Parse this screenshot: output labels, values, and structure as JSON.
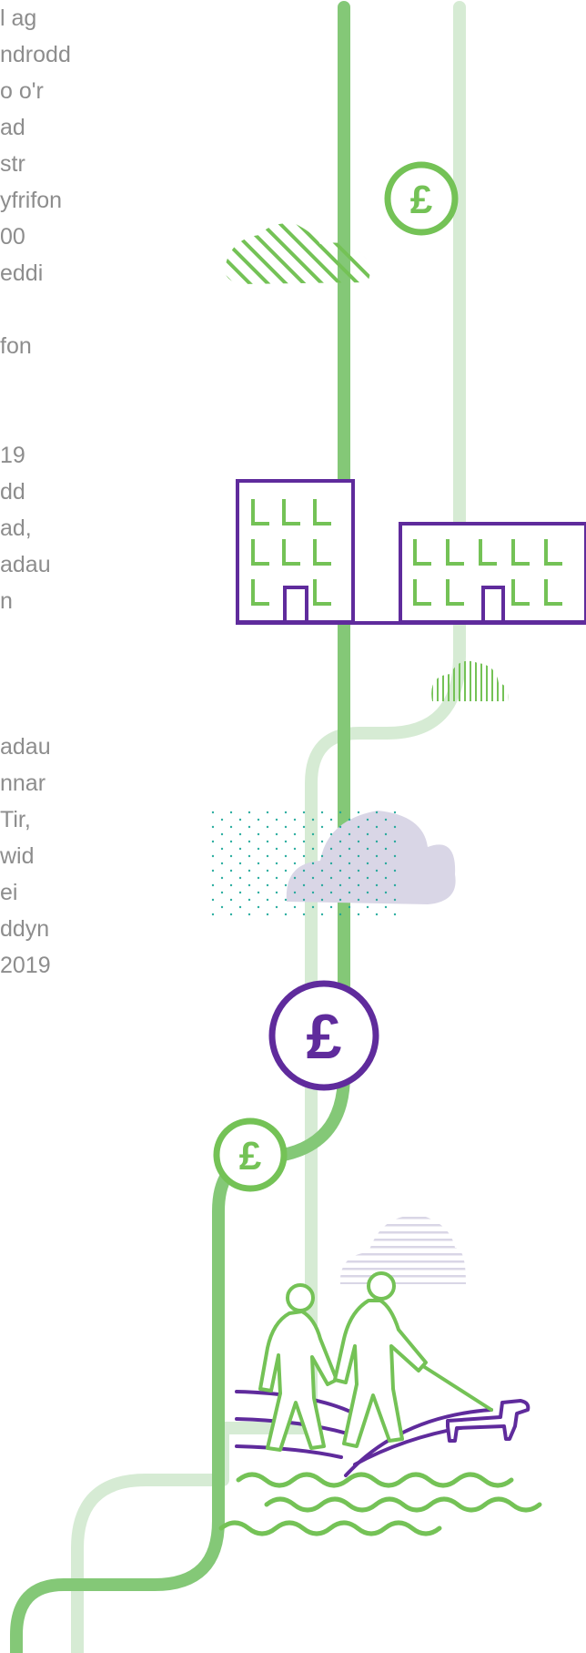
{
  "text_column": {
    "block_1": [
      "l ag",
      "ndrodd",
      "o o'r",
      "ad",
      "str",
      "yfrifon",
      "00",
      "eddi"
    ],
    "block_2": [
      "fon"
    ],
    "block_3": [
      "19",
      "dd",
      "ad,",
      "adau",
      "n"
    ],
    "block_4": [
      "adau",
      "nnar",
      "Tir,",
      "",
      "wid",
      "",
      "ei",
      "",
      "ddyn",
      "2019"
    ]
  },
  "illustration": {
    "colors": {
      "green": "#74c256",
      "green_path": "#84c877",
      "green_faded": "#d6ebd4",
      "purple": "#5f2b9c",
      "cloud_grey": "#d9d6e6",
      "teal": "#16a596"
    },
    "icons": [
      "pound-coin-icon",
      "building-icon",
      "walking-couple-icon",
      "dog-icon",
      "cloud-icon"
    ]
  }
}
